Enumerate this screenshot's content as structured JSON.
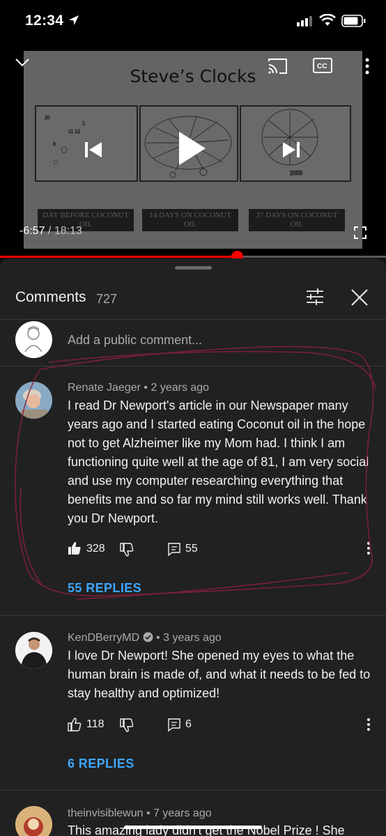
{
  "status_bar": {
    "time": "12:34"
  },
  "video": {
    "slide_title": "Steve’s Clocks",
    "clock_labels": [
      "DAY BEFORE COCONUT OIL",
      "14 DAYS ON COCONUT OIL",
      "37 DAYS ON COCONUT OIL"
    ],
    "elapsed": "-6:57",
    "separator": " / ",
    "duration": "18:13",
    "progress": 0.615
  },
  "comments": {
    "title": "Comments",
    "count": "727",
    "add_placeholder": "Add a public comment...",
    "items": [
      {
        "author": "Renate Jaeger",
        "age": "2 years ago",
        "text": "I read Dr Newport's article in our Newspaper many years ago and I started eating Coconut oil in the hope not to get Alzheimer like my Mom had. I think I am functioning quite well at the age of 81, I am very social and use my computer researching everything that benefits me and so far my mind still works well. Thank you Dr Newport.",
        "likes": "328",
        "reply_count": "55",
        "replies_label": "55 REPLIES"
      },
      {
        "author": "KenDBerryMD",
        "age": "3 years ago",
        "text": "I love Dr Newport!  She opened my eyes to what the human brain is made of, and what it needs to be fed to stay healthy and optimized!",
        "likes": "118",
        "reply_count": "6",
        "replies_label": "6 REPLIES"
      },
      {
        "author": "theinvisiblewun",
        "age": "7 years ago",
        "text": "This amazing lady didn't get the Nobel Prize !  She"
      }
    ]
  },
  "icons": {
    "collapse": "chevron-down-icon",
    "cast": "cast-icon",
    "captions": "captions-icon",
    "more": "more-vert-icon",
    "prev": "skip-previous-icon",
    "play": "play-icon",
    "next": "skip-next-icon",
    "fullscreen": "fullscreen-icon",
    "filter": "filter-icon",
    "close": "close-icon",
    "like": "thumb-up-icon",
    "dislike": "thumb-down-icon",
    "reply": "comment-icon",
    "verified": "verified-icon"
  },
  "colors": {
    "accent_red": "#ff0000",
    "link_blue": "#3ea6ff",
    "panel_bg": "#212121"
  }
}
